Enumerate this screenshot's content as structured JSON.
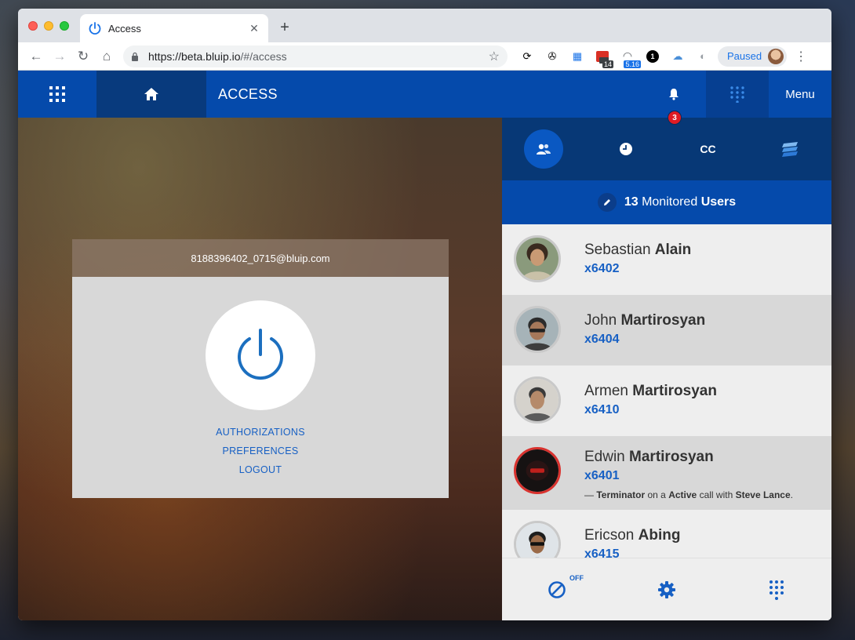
{
  "browser": {
    "tab_title": "Access",
    "url_host": "https://beta.bluip.io",
    "url_path": "/#/access",
    "profile_label": "Paused",
    "ext_badge_1": "14",
    "ext_badge_2": "5.16",
    "ext_badge_3": "1"
  },
  "header": {
    "title": "ACCESS",
    "notifications_count": "3",
    "menu_label": "Menu"
  },
  "account": {
    "email": "8188396402_0715@bluip.com",
    "links": [
      "AUTHORIZATIONS",
      "PREFERENCES",
      "LOGOUT"
    ]
  },
  "panel": {
    "tabs": [
      "users-icon",
      "clock-icon",
      "CC",
      "layers-icon"
    ],
    "cc_label": "CC",
    "title_count": "13",
    "title_mid": "Monitored",
    "title_bold": "Users",
    "users": [
      {
        "first": "Sebastian",
        "last": "Alain",
        "ext": "x6402"
      },
      {
        "first": "John",
        "last": "Martirosyan",
        "ext": "x6404"
      },
      {
        "first": "Armen",
        "last": "Martirosyan",
        "ext": "x6410"
      },
      {
        "first": "Edwin",
        "last": "Martirosyan",
        "ext": "x6401",
        "status_dash": "—",
        "status_device": "Terminator",
        "status_on": "on a",
        "status_state": "Active",
        "status_with": "call with",
        "status_party": "Steve Lance",
        "status_end": "."
      },
      {
        "first": "Ericson",
        "last": "Abing",
        "ext": "x6415"
      }
    ],
    "dnd_label": "OFF"
  },
  "colors": {
    "brand_blue": "#054aab",
    "dark_blue": "#073876",
    "link_blue": "#1760c4",
    "alert_red": "#e01b24"
  }
}
